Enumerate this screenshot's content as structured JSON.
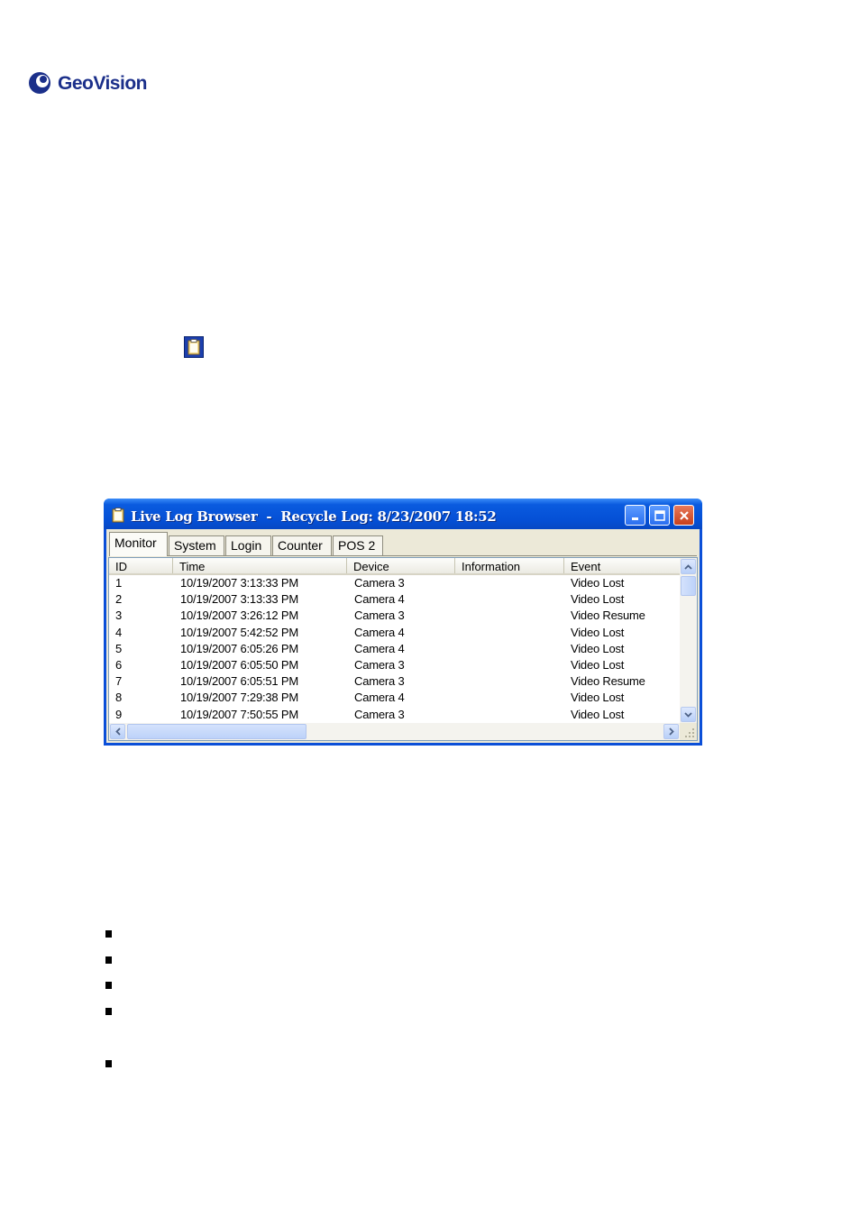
{
  "brand": {
    "name": "GeoVision",
    "color": "#1b2f8a"
  },
  "window": {
    "title": "Live Log Browser  -  Recycle Log: 8/23/2007 18:52",
    "tabs": [
      "Monitor",
      "System",
      "Login",
      "Counter",
      "POS 2"
    ],
    "active_tab": "Monitor",
    "columns": [
      "ID",
      "Time",
      "Device",
      "Information",
      "Event"
    ],
    "rows": [
      {
        "id": "1",
        "time": "10/19/2007 3:13:33 PM",
        "device": "Camera 3",
        "info": "",
        "event": "Video Lost"
      },
      {
        "id": "2",
        "time": "10/19/2007 3:13:33 PM",
        "device": "Camera 4",
        "info": "",
        "event": "Video Lost"
      },
      {
        "id": "3",
        "time": "10/19/2007 3:26:12 PM",
        "device": "Camera 3",
        "info": "",
        "event": "Video Resume"
      },
      {
        "id": "4",
        "time": "10/19/2007 5:42:52 PM",
        "device": "Camera 4",
        "info": "",
        "event": "Video Lost"
      },
      {
        "id": "5",
        "time": "10/19/2007 6:05:26 PM",
        "device": "Camera 4",
        "info": "",
        "event": "Video Lost"
      },
      {
        "id": "6",
        "time": "10/19/2007 6:05:50 PM",
        "device": "Camera 3",
        "info": "",
        "event": "Video Lost"
      },
      {
        "id": "7",
        "time": "10/19/2007 6:05:51 PM",
        "device": "Camera 3",
        "info": "",
        "event": "Video Resume"
      },
      {
        "id": "8",
        "time": "10/19/2007 7:29:38 PM",
        "device": "Camera 4",
        "info": "",
        "event": "Video Lost"
      },
      {
        "id": "9",
        "time": "10/19/2007 7:50:55 PM",
        "device": "Camera 3",
        "info": "",
        "event": "Video Lost"
      }
    ],
    "icons": {
      "title": "clipboard-icon",
      "minimize": "minimize-icon",
      "maximize": "maximize-icon",
      "close": "close-icon"
    },
    "colors": {
      "titlebar": "#0550d6",
      "close_button": "#c8401c",
      "client": "#ece9d8"
    }
  }
}
